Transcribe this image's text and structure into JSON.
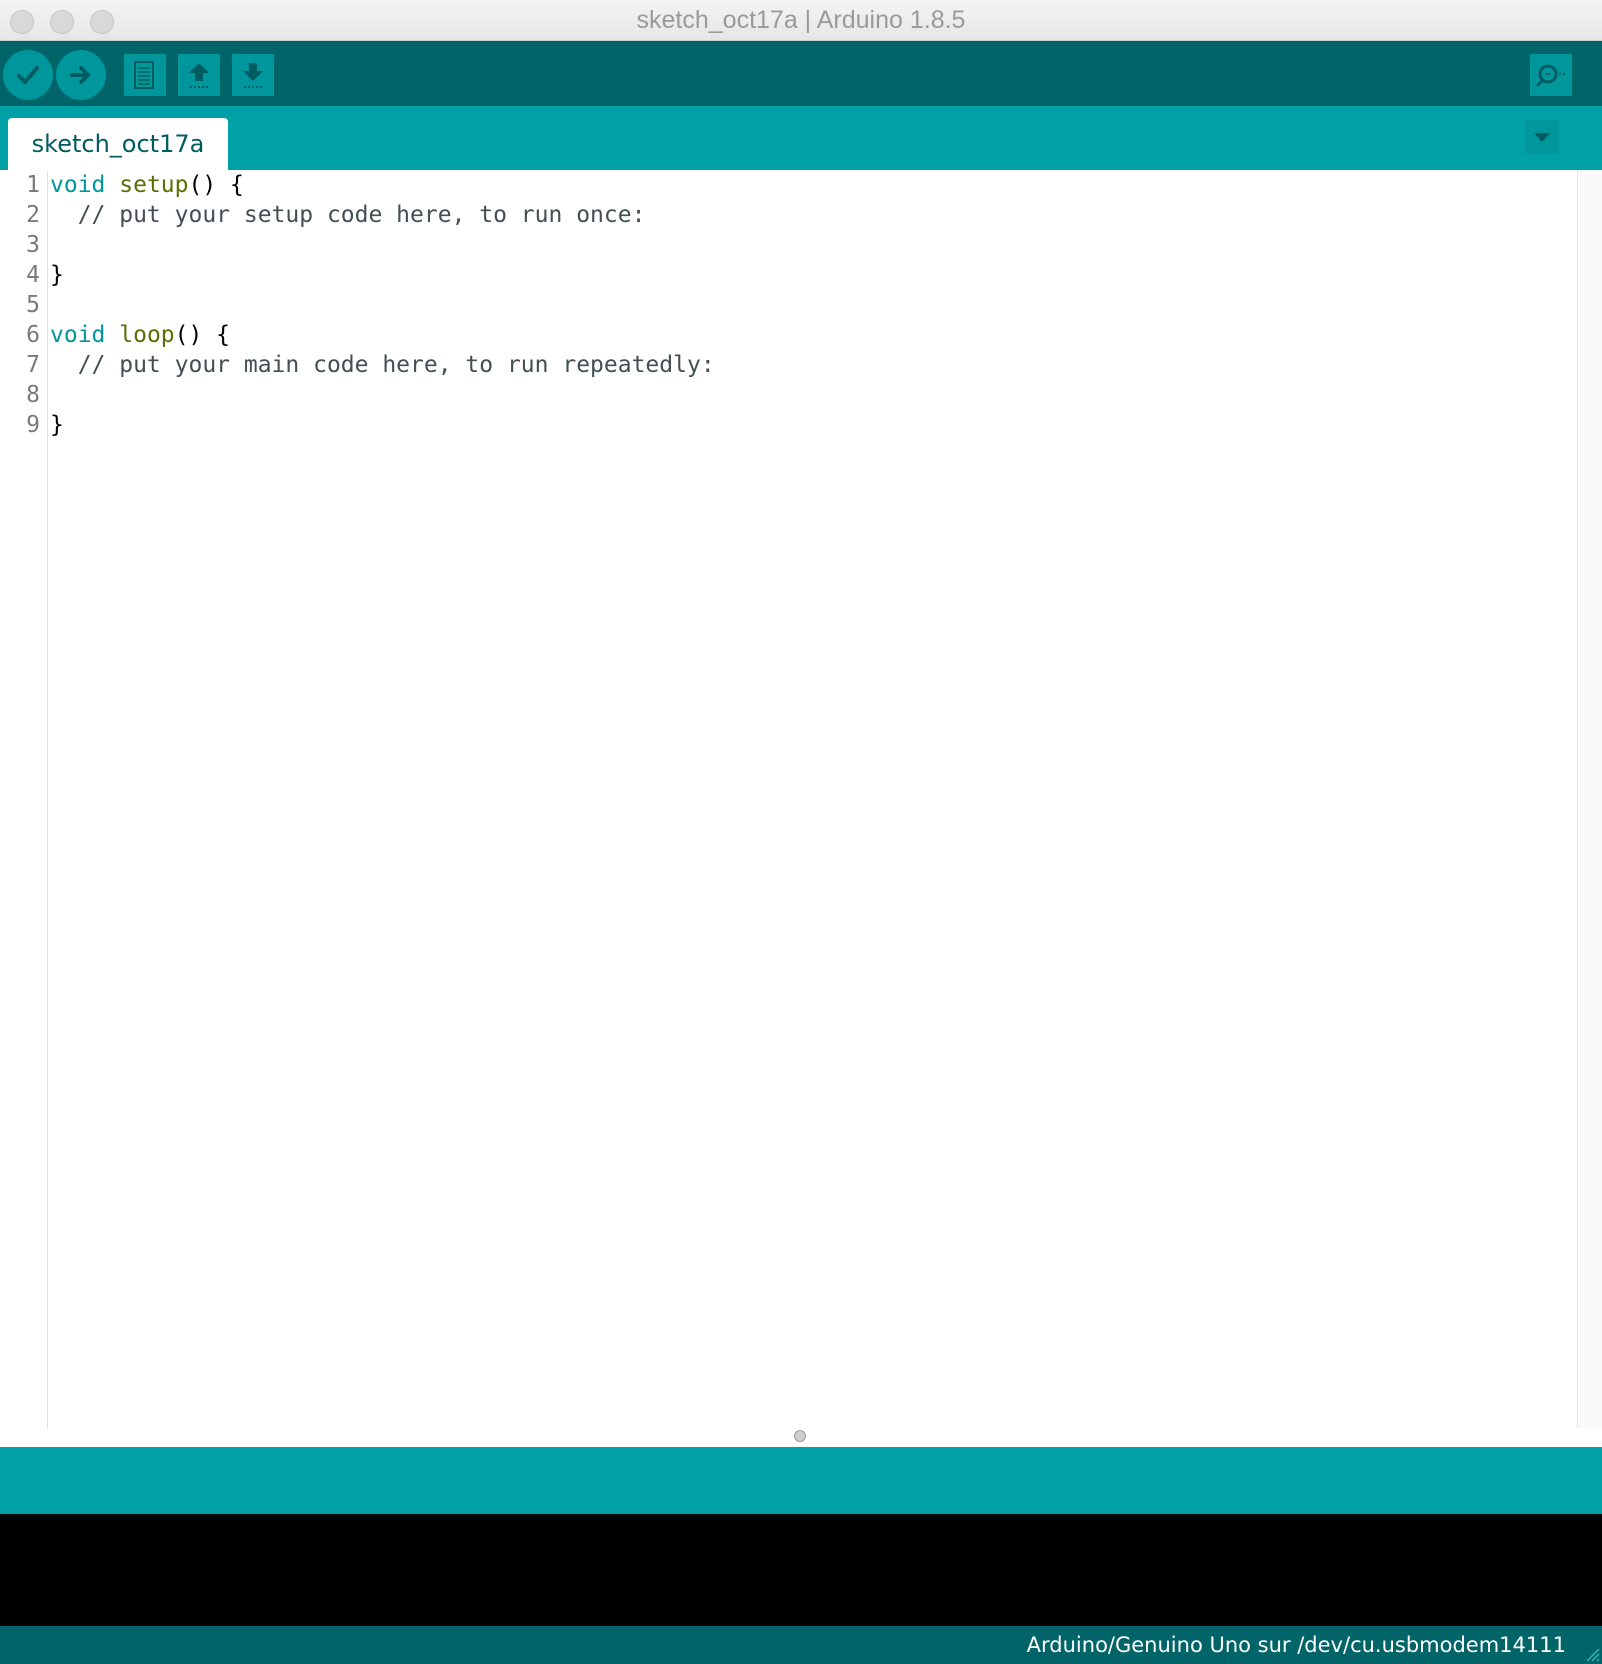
{
  "window": {
    "title": "sketch_oct17a | Arduino 1.8.5"
  },
  "toolbar": {
    "verify_icon": "checkmark-icon",
    "upload_icon": "arrow-right-icon",
    "new_icon": "new-file-icon",
    "open_icon": "upload-arrow-icon",
    "save_icon": "download-arrow-icon",
    "serial_icon": "magnifier-icon"
  },
  "tabs": [
    {
      "label": "sketch_oct17a",
      "active": true
    }
  ],
  "editor": {
    "line_numbers": [
      "1",
      "2",
      "3",
      "4",
      "5",
      "6",
      "7",
      "8",
      "9"
    ],
    "lines": [
      {
        "kw": "void",
        "fn": "setup",
        "rest": "() {"
      },
      {
        "comment": "  // put your setup code here, to run once:"
      },
      {
        "text": ""
      },
      {
        "text": "}"
      },
      {
        "text": ""
      },
      {
        "kw": "void",
        "fn": "loop",
        "rest": "() {"
      },
      {
        "comment": "  // put your main code here, to run repeatedly:"
      },
      {
        "text": ""
      },
      {
        "text": "}"
      }
    ]
  },
  "statusbar": {
    "board_text": "Arduino/Genuino Uno sur /dev/cu.usbmodem14111"
  },
  "colors": {
    "toolbar_bg": "#006468",
    "tabbar_bg": "#00a1a6",
    "button_bg": "#00979c",
    "keyword": "#00979c",
    "function": "#5e6d03",
    "console_bg": "#000000"
  }
}
